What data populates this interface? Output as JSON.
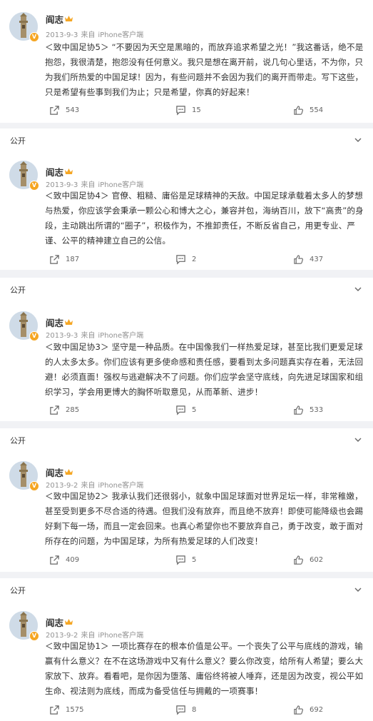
{
  "ui": {
    "visibility_label": "公开",
    "source_prefix": "来自",
    "chevron_icon": "chevron-down-icon",
    "repost_icon": "repost-icon",
    "comment_icon": "comment-icon",
    "like_icon": "like-thumb-icon",
    "badge_color": "#f5a623"
  },
  "posts": [
    {
      "author": "阎志",
      "date": "2013-9-3",
      "source": "iPhone客户端",
      "text": "＜致中国足协5＞ “不要因为天空是黑暗的，而放弃追求希望之光！”我这番话，绝不是抱怨，我很清楚，抱怨没有任何意义。我只是想在离开前，说几句心里话，不为你，只为我们所热爱的中国足球！因为，有些问题并不会因为我们的离开而带走。写下这些，只是希望有些事到我们为止；只是希望，你真的好起来！",
      "reposts": "543",
      "comments": "15",
      "likes": "554"
    },
    {
      "author": "阎志",
      "date": "2013-9-3",
      "source": "iPhone客户端",
      "text": "＜致中国足协4＞ 官僚、粗糙、庸俗是足球精神的天敌。中国足球承载着太多人的梦想与热爱，你应该学会秉承一颗公心和博大之心，兼容并包，海纳百川，放下“高贵”的身段，主动跳出所谓的“圈子”，积极作为，不推卸责任，不断反省自己，用更专业、严谨、公平的精神建立自己的公信。",
      "reposts": "187",
      "comments": "2",
      "likes": "437"
    },
    {
      "author": "阎志",
      "date": "2013-9-3",
      "source": "iPhone客户端",
      "text": "＜致中国足协3＞ 坚守是一种品质。在中国像我们一样热爱足球，甚至比我们更爱足球的人太多太多。你们应该有更多使命感和责任感，要看到太多问题真实存在着，无法回避！必须直面！强权与逃避解决不了问题。你们应学会坚守底线，向先进足球国家和组织学习，学会用更博大的胸怀听取意见，从而革新、进步！",
      "reposts": "285",
      "comments": "5",
      "likes": "533"
    },
    {
      "author": "阎志",
      "date": "2013-9-2",
      "source": "iPhone客户端",
      "text": "＜致中国足协2＞ 我承认我们还很弱小，就象中国足球面对世界足坛一样，非常稚嫩，甚至受到更多不尽合适的待遇。但我们没有放弃，而且绝不放弃！即使可能降级也会踢好剩下每一场，而且一定会回来。也真心希望你也不要放弃自己，勇于改变，敢于面对所存在的问题，为中国足球，为所有热爱足球的人们改变！",
      "reposts": "409",
      "comments": "5",
      "likes": "602"
    },
    {
      "author": "阎志",
      "date": "2013-9-2",
      "source": "iPhone客户端",
      "text": "＜致中国足协1＞ 一项比赛存在的根本价值是公平。一个丧失了公平与底线的游戏，输赢有什么意义？在不在这场游戏中又有什么意义？要么你改变，给所有人希望；要么大家放下、放弃。看看吧，是你因为堕落、庸俗终将被人唾弃，还是因为改变，视公平如生命、视法则为底线，而成为备受信任与拥戴的一项赛事！",
      "reposts": "1575",
      "comments": "8",
      "likes": "692"
    }
  ]
}
